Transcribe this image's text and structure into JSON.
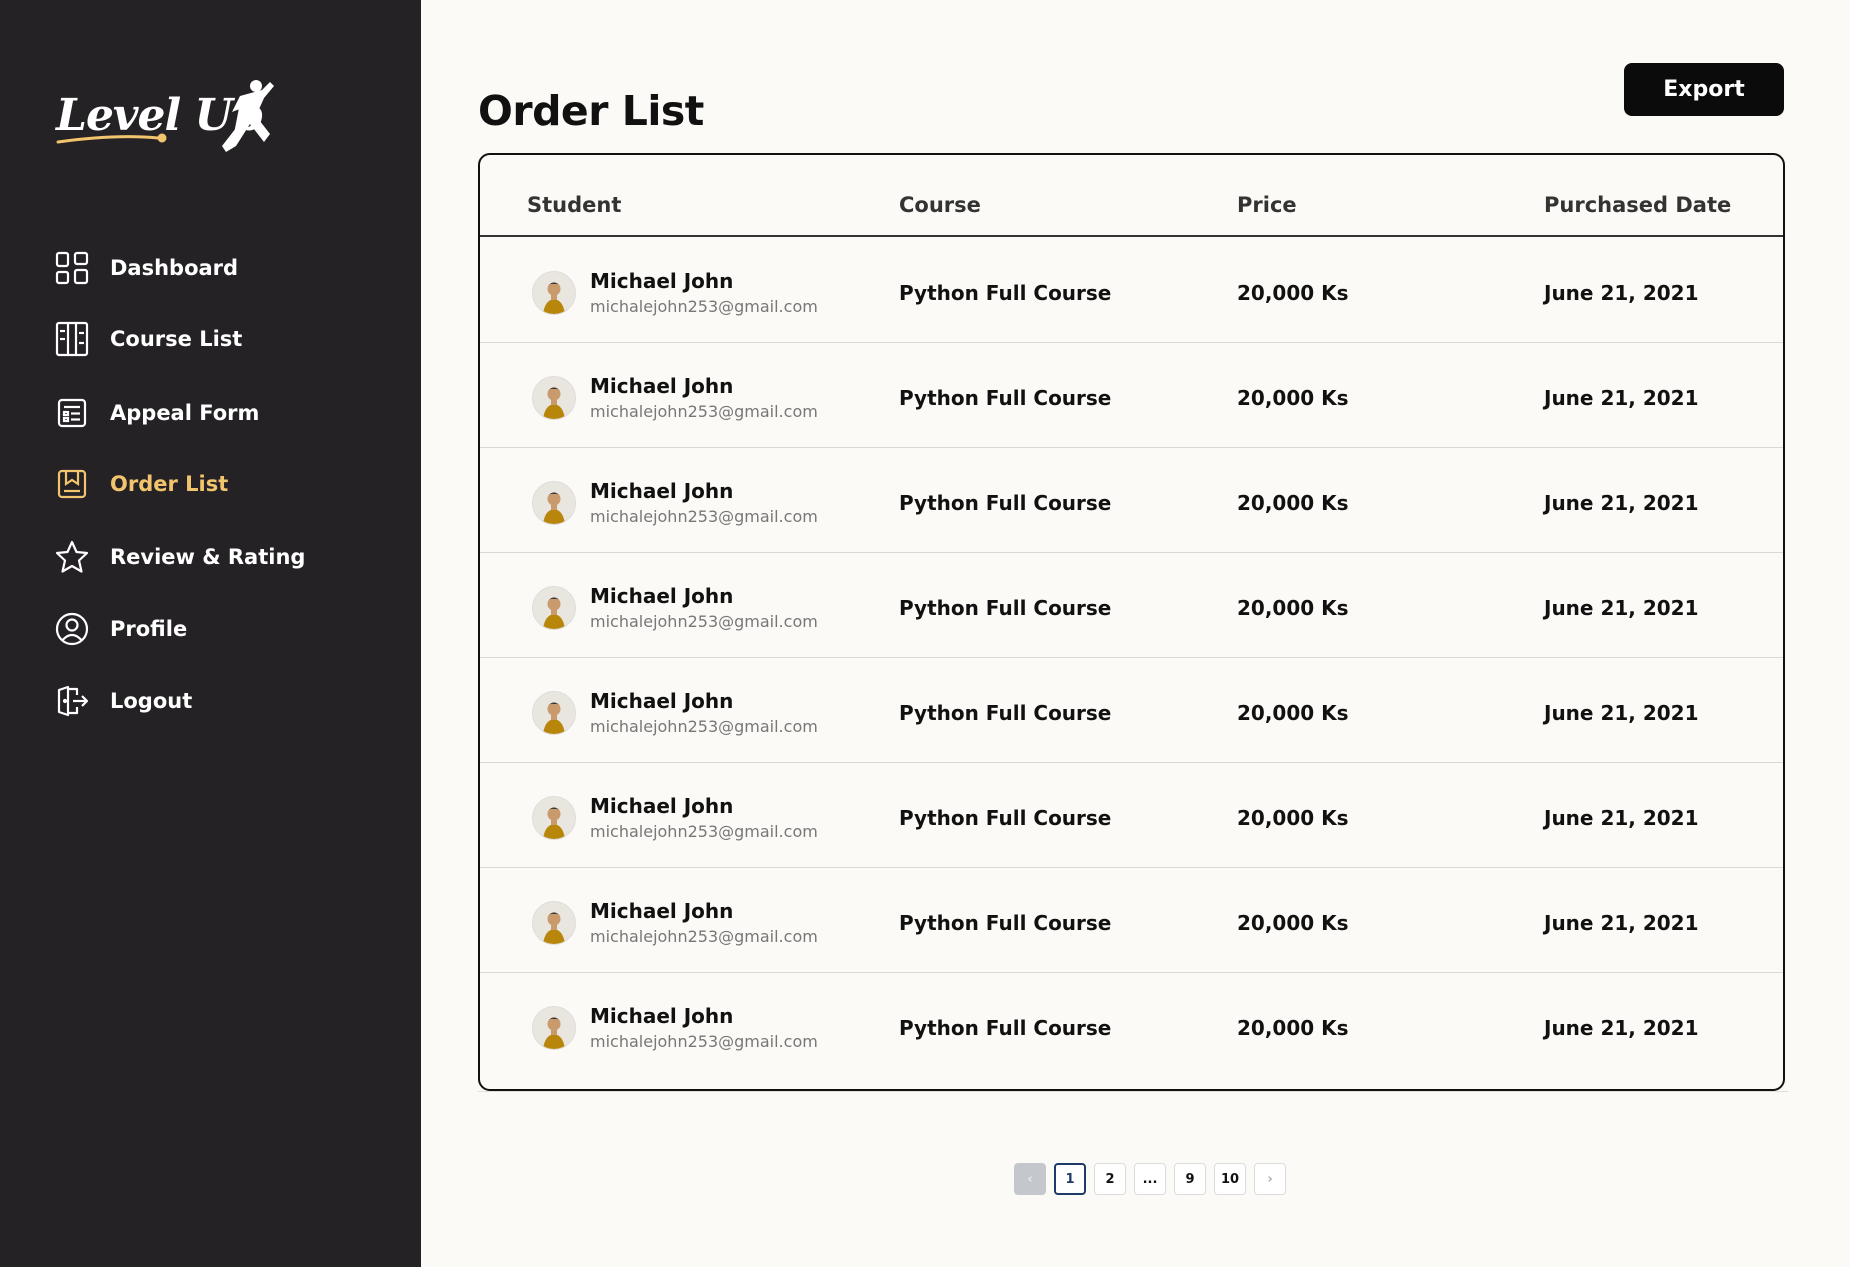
{
  "brand": {
    "logo_text": "Level Up"
  },
  "sidebar": {
    "items": [
      {
        "label": "Dashboard",
        "icon": "dashboard-icon"
      },
      {
        "label": "Course List",
        "icon": "course-list-icon"
      },
      {
        "label": "Appeal Form",
        "icon": "form-icon"
      },
      {
        "label": "Order List",
        "icon": "order-icon",
        "active": true
      },
      {
        "label": "Review & Rating",
        "icon": "star-icon"
      },
      {
        "label": "Profile",
        "icon": "profile-icon"
      },
      {
        "label": "Logout",
        "icon": "logout-icon"
      }
    ]
  },
  "header": {
    "title": "Order List",
    "export_label": "Export"
  },
  "table": {
    "columns": [
      "Student",
      "Course",
      "Price",
      "Purchased Date"
    ],
    "rows": [
      {
        "name": "Michael John",
        "email": "michalejohn253@gmail.com",
        "course": "Python Full Course",
        "price": "20,000 Ks",
        "date": "June 21, 2021"
      },
      {
        "name": "Michael John",
        "email": "michalejohn253@gmail.com",
        "course": "Python Full Course",
        "price": "20,000 Ks",
        "date": "June 21, 2021"
      },
      {
        "name": "Michael John",
        "email": "michalejohn253@gmail.com",
        "course": "Python Full Course",
        "price": "20,000 Ks",
        "date": "June 21, 2021"
      },
      {
        "name": "Michael John",
        "email": "michalejohn253@gmail.com",
        "course": "Python Full Course",
        "price": "20,000 Ks",
        "date": "June 21, 2021"
      },
      {
        "name": "Michael John",
        "email": "michalejohn253@gmail.com",
        "course": "Python Full Course",
        "price": "20,000 Ks",
        "date": "June 21, 2021"
      },
      {
        "name": "Michael John",
        "email": "michalejohn253@gmail.com",
        "course": "Python Full Course",
        "price": "20,000 Ks",
        "date": "June 21, 2021"
      },
      {
        "name": "Michael John",
        "email": "michalejohn253@gmail.com",
        "course": "Python Full Course",
        "price": "20,000 Ks",
        "date": "June 21, 2021"
      },
      {
        "name": "Michael John",
        "email": "michalejohn253@gmail.com",
        "course": "Python Full Course",
        "price": "20,000 Ks",
        "date": "June 21, 2021"
      }
    ]
  },
  "pagination": {
    "prev": "‹",
    "pages": [
      "1",
      "2",
      "...",
      "9",
      "10"
    ],
    "next": "›",
    "current": "1"
  },
  "colors": {
    "sidebar_bg": "#252225",
    "accent": "#F2C46D",
    "page_bg": "#FCFAF6",
    "button_bg": "#0B0B0B"
  }
}
